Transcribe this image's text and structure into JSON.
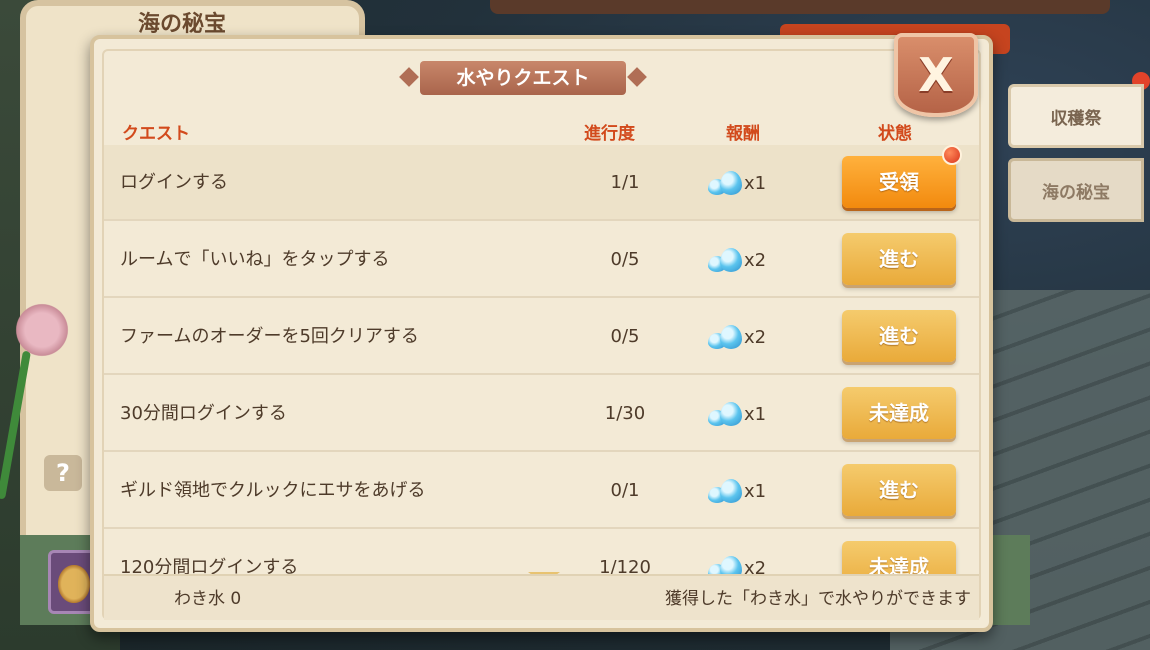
{
  "background": {
    "back_window_title": "海の秘宝",
    "help_label": "?"
  },
  "side_tabs": [
    {
      "label": "収穫祭"
    },
    {
      "label": "海の秘宝"
    }
  ],
  "dialog": {
    "title": "水やりクエスト",
    "close_label": "X",
    "columns": {
      "quest": "クエスト",
      "progress": "進行度",
      "reward": "報酬",
      "status": "状態"
    },
    "rows": [
      {
        "name": "ログインする",
        "progress": "1/1",
        "reward_icon": "water-drop-icon",
        "reward_qty": "x1",
        "status": "受領",
        "status_type": "claim",
        "has_badge": true
      },
      {
        "name": "ルームで「いいね」をタップする",
        "progress": "0/5",
        "reward_icon": "water-drop-icon",
        "reward_qty": "x2",
        "status": "進む",
        "status_type": "go"
      },
      {
        "name": "ファームのオーダーを5回クリアする",
        "progress": "0/5",
        "reward_icon": "water-drop-icon",
        "reward_qty": "x2",
        "status": "進む",
        "status_type": "go"
      },
      {
        "name": "30分間ログインする",
        "progress": "1/30",
        "reward_icon": "water-drop-icon",
        "reward_qty": "x1",
        "status": "未達成",
        "status_type": "incomplete"
      },
      {
        "name": "ギルド領地でクルックにエサをあげる",
        "progress": "0/1",
        "reward_icon": "water-drop-icon",
        "reward_qty": "x1",
        "status": "進む",
        "status_type": "go"
      },
      {
        "name": "120分間ログインする",
        "progress": "1/120",
        "reward_icon": "water-drop-icon",
        "reward_qty": "x2",
        "status": "未達成",
        "status_type": "incomplete"
      }
    ],
    "footer": {
      "water_count": "わき水 0",
      "hint": "獲得した「わき水」で水やりができます"
    }
  }
}
